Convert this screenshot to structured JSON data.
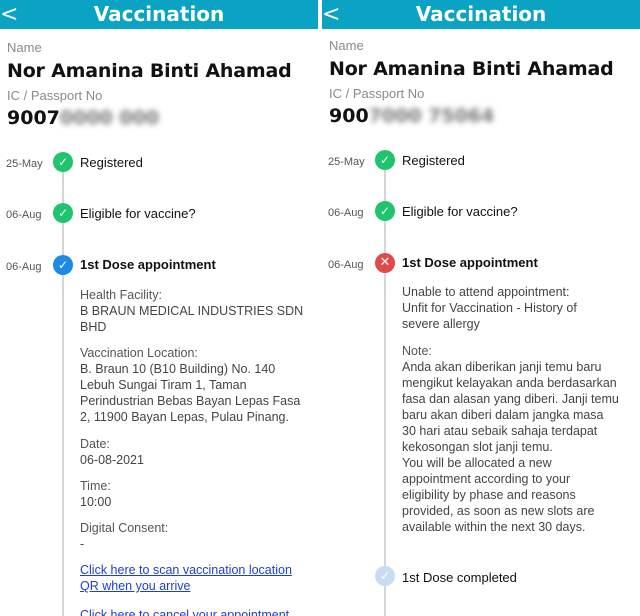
{
  "left": {
    "header": {
      "back_icon": "chevron-left-icon",
      "back_glyph": "<",
      "title": "Vaccination"
    },
    "profile": {
      "name_label": "Name",
      "name": "Nor Amanina Binti Ahamad",
      "ic_label": "IC / Passport No",
      "ic_visible": "9007",
      "ic_blurred": "0000 000"
    },
    "timeline": [
      {
        "date": "25-May",
        "label": "Registered",
        "status": "done"
      },
      {
        "date": "06-Aug",
        "label": "Eligible for vaccine?",
        "status": "done"
      },
      {
        "date": "06-Aug",
        "label": "1st Dose appointment",
        "status": "confirmed"
      }
    ],
    "details": {
      "facility_label": "Health Facility:",
      "facility_lines": [
        "B BRAUN MEDICAL INDUSTRIES SDN",
        "BHD"
      ],
      "location_label": "Vaccination Location:",
      "location_lines": [
        "B. Braun 10 (B10 Building) No. 140",
        "Lebuh Sungai Tiram 1, Taman",
        "Perindustrian Bebas Bayan Lepas Fasa",
        "2, 11900 Bayan Lepas, Pulau Pinang."
      ],
      "date_label": "Date:",
      "date_value": "06-08-2021",
      "time_label": "Time:",
      "time_value": "10:00",
      "consent_label": "Digital Consent:",
      "consent_value": "-",
      "scan_link_lines": [
        "Click here to scan vaccination location",
        "QR when you arrive"
      ],
      "cancel_link": "Click here to cancel your appointment"
    }
  },
  "right": {
    "header": {
      "back_icon": "chevron-left-icon",
      "back_glyph": "<",
      "title": "Vaccination"
    },
    "profile": {
      "name_label": "Name",
      "name": "Nor Amanina Binti Ahamad",
      "ic_label": "IC / Passport No",
      "ic_visible": "900",
      "ic_blurred": "7000 75064"
    },
    "timeline": [
      {
        "date": "25-May",
        "label": "Registered",
        "status": "done"
      },
      {
        "date": "06-Aug",
        "label": "Eligible for vaccine?",
        "status": "done"
      },
      {
        "date": "06-Aug",
        "label": "1st Dose appointment",
        "status": "failed"
      },
      {
        "date": "",
        "label": "1st Dose completed",
        "status": "pending"
      }
    ],
    "details": {
      "unable_lines": [
        "Unable to attend appointment:",
        "Unfit for Vaccination - History of",
        "severe allergy"
      ],
      "note_label": "Note:",
      "note_lines": [
        "Anda akan diberikan janji temu baru",
        "mengikut kelayakan anda berdasarkan",
        "fasa dan alasan yang diberi. Janji temu",
        "baru akan diberi dalam jangka masa",
        "30 hari atau sebaik sahaja terdapat",
        "kekosongan slot janji temu.",
        "You will be allocated a new",
        "appointment according to your",
        "eligibility by phase and reasons",
        "provided, as soon as new slots are",
        "available within the next 30 days."
      ]
    }
  },
  "colors": {
    "header": "#0aa3c4",
    "done": "#1fc46e",
    "confirmed": "#1e8ae6",
    "failed": "#e04a4a",
    "pending": "#c8dcf2",
    "link": "#1a3fd6"
  }
}
